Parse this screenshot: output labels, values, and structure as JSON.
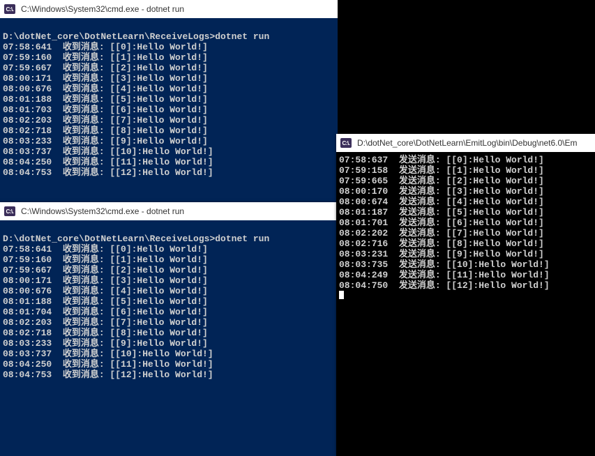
{
  "windows": {
    "win1": {
      "icon_label": "C:\\.",
      "title": "C:\\Windows\\System32\\cmd.exe - dotnet  run",
      "prompt": "D:\\dotNet_core\\DotNetLearn\\ReceiveLogs>dotnet run",
      "msg_label": "收到消息:",
      "lines": [
        {
          "time": "07:58:641",
          "idx": 0,
          "msg": "Hello World!"
        },
        {
          "time": "07:59:160",
          "idx": 1,
          "msg": "Hello World!"
        },
        {
          "time": "07:59:667",
          "idx": 2,
          "msg": "Hello World!"
        },
        {
          "time": "08:00:171",
          "idx": 3,
          "msg": "Hello World!"
        },
        {
          "time": "08:00:676",
          "idx": 4,
          "msg": "Hello World!"
        },
        {
          "time": "08:01:188",
          "idx": 5,
          "msg": "Hello World!"
        },
        {
          "time": "08:01:703",
          "idx": 6,
          "msg": "Hello World!"
        },
        {
          "time": "08:02:203",
          "idx": 7,
          "msg": "Hello World!"
        },
        {
          "time": "08:02:718",
          "idx": 8,
          "msg": "Hello World!"
        },
        {
          "time": "08:03:233",
          "idx": 9,
          "msg": "Hello World!"
        },
        {
          "time": "08:03:737",
          "idx": 10,
          "msg": "Hello World!"
        },
        {
          "time": "08:04:250",
          "idx": 11,
          "msg": "Hello World!"
        },
        {
          "time": "08:04:753",
          "idx": 12,
          "msg": "Hello World!"
        }
      ]
    },
    "win2": {
      "icon_label": "C:\\.",
      "title": "C:\\Windows\\System32\\cmd.exe - dotnet  run",
      "prompt": "D:\\dotNet_core\\DotNetLearn\\ReceiveLogs>dotnet run",
      "msg_label": "收到消息:",
      "lines": [
        {
          "time": "07:58:641",
          "idx": 0,
          "msg": "Hello World!"
        },
        {
          "time": "07:59:160",
          "idx": 1,
          "msg": "Hello World!"
        },
        {
          "time": "07:59:667",
          "idx": 2,
          "msg": "Hello World!"
        },
        {
          "time": "08:00:171",
          "idx": 3,
          "msg": "Hello World!"
        },
        {
          "time": "08:00:676",
          "idx": 4,
          "msg": "Hello World!"
        },
        {
          "time": "08:01:188",
          "idx": 5,
          "msg": "Hello World!"
        },
        {
          "time": "08:01:704",
          "idx": 6,
          "msg": "Hello World!"
        },
        {
          "time": "08:02:203",
          "idx": 7,
          "msg": "Hello World!"
        },
        {
          "time": "08:02:718",
          "idx": 8,
          "msg": "Hello World!"
        },
        {
          "time": "08:03:233",
          "idx": 9,
          "msg": "Hello World!"
        },
        {
          "time": "08:03:737",
          "idx": 10,
          "msg": "Hello World!"
        },
        {
          "time": "08:04:250",
          "idx": 11,
          "msg": "Hello World!"
        },
        {
          "time": "08:04:753",
          "idx": 12,
          "msg": "Hello World!"
        }
      ]
    },
    "win3": {
      "icon_label": "C:\\.",
      "title": "D:\\dotNet_core\\DotNetLearn\\EmitLog\\bin\\Debug\\net6.0\\Em",
      "msg_label": "发送消息:",
      "lines": [
        {
          "time": "07:58:637",
          "idx": 0,
          "msg": "Hello World!"
        },
        {
          "time": "07:59:158",
          "idx": 1,
          "msg": "Hello World!"
        },
        {
          "time": "07:59:665",
          "idx": 2,
          "msg": "Hello World!"
        },
        {
          "time": "08:00:170",
          "idx": 3,
          "msg": "Hello World!"
        },
        {
          "time": "08:00:674",
          "idx": 4,
          "msg": "Hello World!"
        },
        {
          "time": "08:01:187",
          "idx": 5,
          "msg": "Hello World!"
        },
        {
          "time": "08:01:701",
          "idx": 6,
          "msg": "Hello World!"
        },
        {
          "time": "08:02:202",
          "idx": 7,
          "msg": "Hello World!"
        },
        {
          "time": "08:02:716",
          "idx": 8,
          "msg": "Hello World!"
        },
        {
          "time": "08:03:231",
          "idx": 9,
          "msg": "Hello World!"
        },
        {
          "time": "08:03:735",
          "idx": 10,
          "msg": "Hello World!"
        },
        {
          "time": "08:04:249",
          "idx": 11,
          "msg": "Hello World!"
        },
        {
          "time": "08:04:750",
          "idx": 12,
          "msg": "Hello World!"
        }
      ]
    }
  }
}
